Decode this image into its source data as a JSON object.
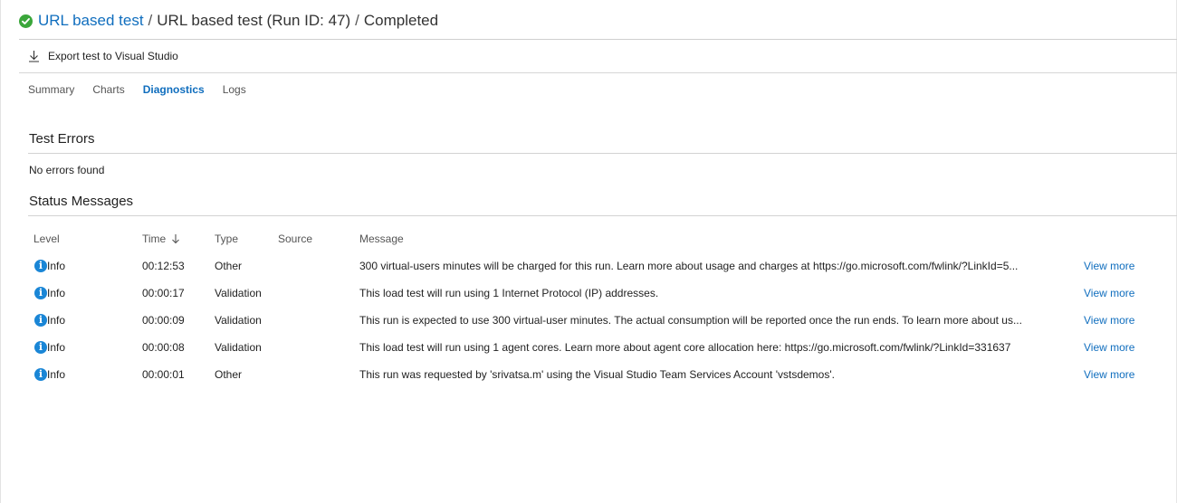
{
  "header": {
    "status_icon": "check-circle-icon",
    "status_color": "#3aa63a",
    "test_link": "URL based test",
    "separator": "/",
    "test_name": "URL based test (Run ID: 47)",
    "status": "Completed"
  },
  "toolbar": {
    "export_icon": "download-icon",
    "export_label": "Export test to Visual Studio"
  },
  "tabs": [
    {
      "label": "Summary",
      "active": false
    },
    {
      "label": "Charts",
      "active": false
    },
    {
      "label": "Diagnostics",
      "active": true
    },
    {
      "label": "Logs",
      "active": false
    }
  ],
  "test_errors": {
    "title": "Test Errors",
    "empty_text": "No errors found"
  },
  "status_messages": {
    "title": "Status Messages",
    "columns": {
      "level": "Level",
      "time": "Time",
      "time_sort_icon": "arrow-down-icon",
      "type": "Type",
      "source": "Source",
      "message": "Message"
    },
    "rows": [
      {
        "level": "Info",
        "time": "00:12:53",
        "type": "Other",
        "source": "",
        "message": "300 virtual-users minutes will be charged for this run. Learn more about usage and charges at https://go.microsoft.com/fwlink/?LinkId=5...",
        "action": "View more"
      },
      {
        "level": "Info",
        "time": "00:00:17",
        "type": "Validation",
        "source": "",
        "message": "This load test will run using 1 Internet Protocol (IP) addresses.",
        "action": "View more"
      },
      {
        "level": "Info",
        "time": "00:00:09",
        "type": "Validation",
        "source": "",
        "message": "This run is expected to use 300 virtual-user minutes. The actual consumption will be reported once the run ends. To learn more about us...",
        "action": "View more"
      },
      {
        "level": "Info",
        "time": "00:00:08",
        "type": "Validation",
        "source": "",
        "message": "This load test will run using 1 agent cores. Learn more about agent core allocation here: https://go.microsoft.com/fwlink/?LinkId=331637",
        "action": "View more"
      },
      {
        "level": "Info",
        "time": "00:00:01",
        "type": "Other",
        "source": "",
        "message": "This run was requested by 'srivatsa.m' using the Visual Studio Team Services Account 'vstsdemos'.",
        "action": "View more"
      }
    ]
  }
}
